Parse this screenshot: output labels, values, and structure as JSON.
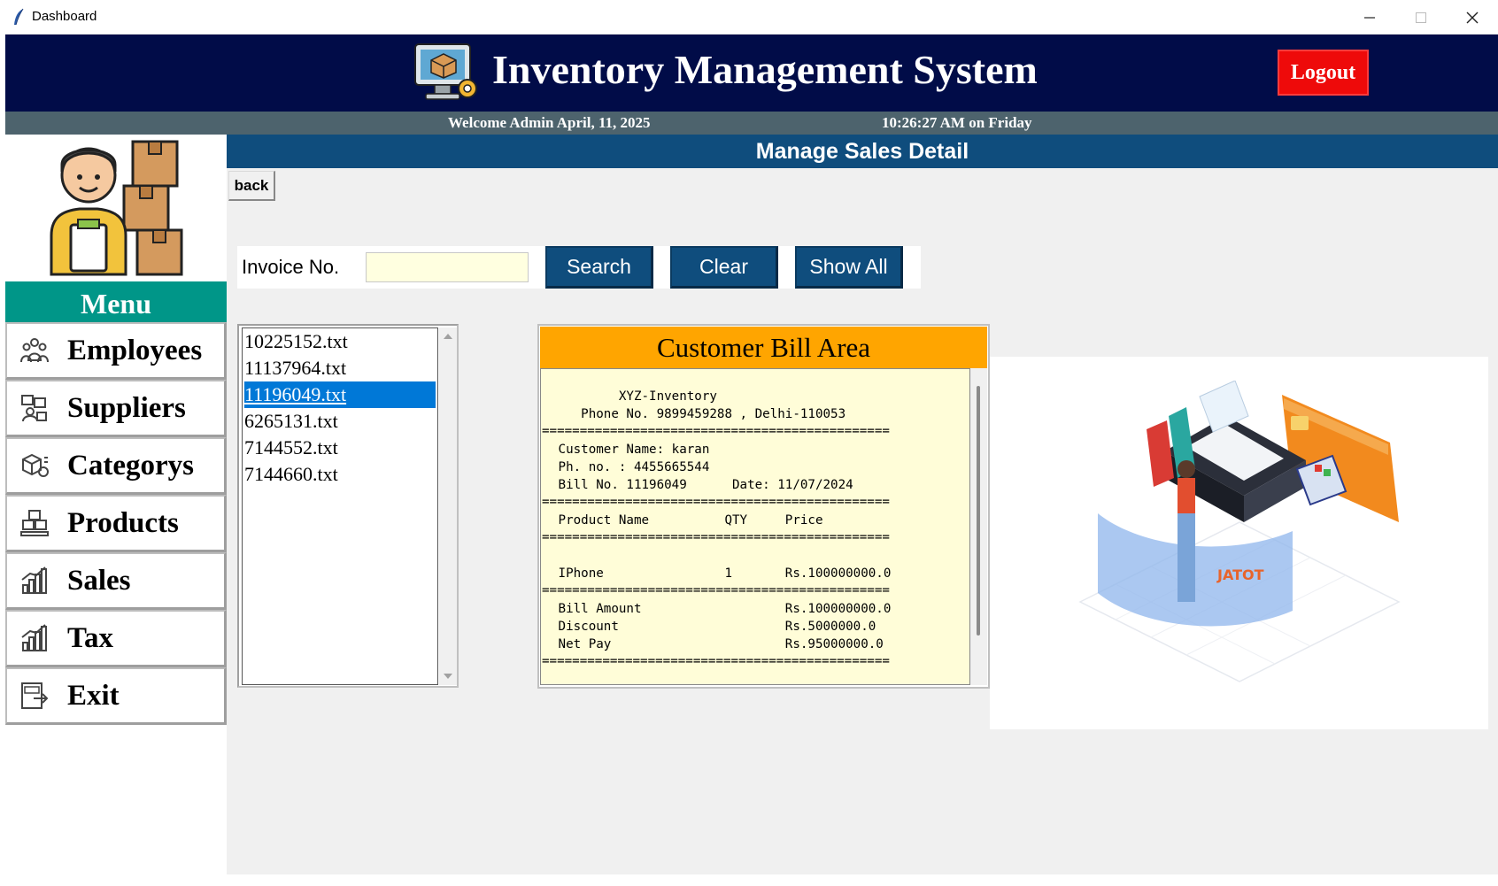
{
  "window": {
    "title": "Dashboard",
    "controls": [
      "minimize",
      "maximize",
      "close"
    ]
  },
  "header": {
    "title": "Inventory Management System",
    "logout_label": "Logout"
  },
  "status": {
    "welcome": "Welcome Admin  April, 11, 2025",
    "clock": "10:26:27 AM on Friday"
  },
  "sidebar": {
    "menu_label": "Menu",
    "items": [
      {
        "label": "Employees",
        "icon": "employees-icon"
      },
      {
        "label": "Suppliers",
        "icon": "suppliers-icon"
      },
      {
        "label": "Categorys",
        "icon": "categories-icon"
      },
      {
        "label": "Products",
        "icon": "products-icon"
      },
      {
        "label": "Sales",
        "icon": "sales-chart-icon"
      },
      {
        "label": "Tax",
        "icon": "tax-chart-icon"
      },
      {
        "label": "Exit",
        "icon": "exit-icon"
      }
    ]
  },
  "main": {
    "section_title": "Manage Sales Detail",
    "back_label": "back",
    "search": {
      "label": "Invoice No.",
      "input_value": "",
      "search_label": "Search",
      "clear_label": "Clear",
      "show_all_label": "Show All"
    },
    "invoices": {
      "items": [
        "10225152.txt",
        "11137964.txt",
        "11196049.txt",
        "6265131.txt",
        "7144552.txt",
        "7144660.txt"
      ],
      "selected": "11196049.txt"
    },
    "bill": {
      "title": "Customer Bill Area",
      "lines": [
        "         XYZ-Inventory",
        "    Phone No. 9899459288 , Delhi-110053",
        "==============================================",
        " Customer Name: karan",
        " Ph. no. : 4455665544",
        " Bill No. 11196049      Date: 11/07/2024",
        "==============================================",
        " Product Name          QTY     Price",
        "==============================================",
        "",
        " IPhone                1       Rs.100000000.0",
        "==============================================",
        " Bill Amount                   Rs.100000000.0",
        " Discount                      Rs.5000000.0",
        " Net Pay                       Rs.95000000.0",
        "=============================================="
      ]
    },
    "illustration_text": "JATOT"
  },
  "colors": {
    "header_bg": "#010C48",
    "status_bg": "#4D636D",
    "menu_bg": "#009688",
    "section_bg": "#0F4D7D",
    "logout_bg": "#EE0A0A",
    "bill_header_bg": "#FFA500",
    "bill_body_bg": "#FFFDD8",
    "selection_bg": "#0078D7"
  }
}
